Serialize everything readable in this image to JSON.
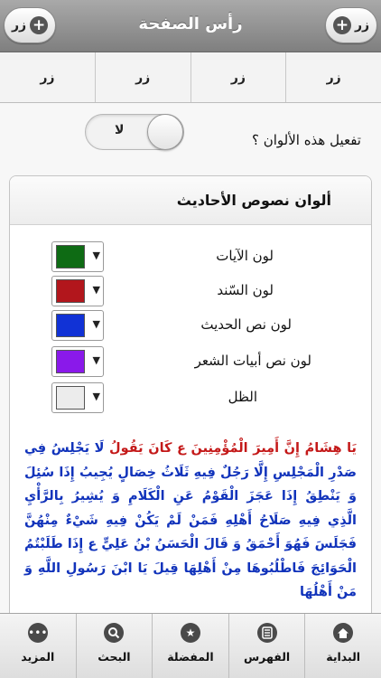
{
  "header": {
    "title": "رأس الصفحة",
    "left_button": "زر",
    "right_button": "زر"
  },
  "segments": [
    "زر",
    "زر",
    "زر",
    "زر"
  ],
  "toggle": {
    "label": "تفعيل هذه الألوان ؟",
    "state_text": "لا"
  },
  "colors_card": {
    "title": "ألوان نصوص الأحاديث",
    "rows": [
      {
        "label": "لون الآيات",
        "color": "#0e6b14"
      },
      {
        "label": "لون السّند",
        "color": "#b2161c"
      },
      {
        "label": "لون نص الحديث",
        "color": "#1132d6"
      },
      {
        "label": "لون نص أبيات الشعر",
        "color": "#8a19ea"
      },
      {
        "label": "الظل",
        "color": "#ececec"
      }
    ]
  },
  "hadith": {
    "red_text": "يَا هِشَامُ إِنَّ أَمِيرَ الْمُؤْمِنِينَ ع كَانَ يَقُولُ",
    "blue_text": "لَا يَجْلِسُ فِي صَدْرِ الْمَجْلِسِ إِلَّا رَجُلٌ فِيهِ ثَلَاثُ خِصَالٍ يُجِيبُ إِذَا سُئِلَ وَ يَنْطِقُ إِذَا عَجَزَ الْقَوْمُ عَنِ الْكَلَامِ وَ يُشِيرُ بِالرَّأْيِ الَّذِي فِيهِ صَلَاحُ أَهْلِهِ فَمَنْ لَمْ يَكُنْ فِيهِ شَيْءٌ مِنْهُنَّ فَجَلَسَ فَهُوَ أَحْمَقُ وَ قَالَ الْحَسَنُ بْنُ عَلِيٍّ ع إِذَا طَلَبْتُمُ الْحَوَائِجَ فَاطْلُبُوهَا مِنْ أَهْلِهَا قِيلَ يَا ابْنَ رَسُولِ اللَّهِ وَ مَنْ أَهْلُهَا"
  },
  "tabbar": [
    {
      "label": "البداية",
      "icon": "home-icon"
    },
    {
      "label": "الفهرس",
      "icon": "index-icon"
    },
    {
      "label": "المفضلة",
      "icon": "star-icon"
    },
    {
      "label": "البحث",
      "icon": "search-icon"
    },
    {
      "label": "المزيد",
      "icon": "more-icon"
    }
  ]
}
